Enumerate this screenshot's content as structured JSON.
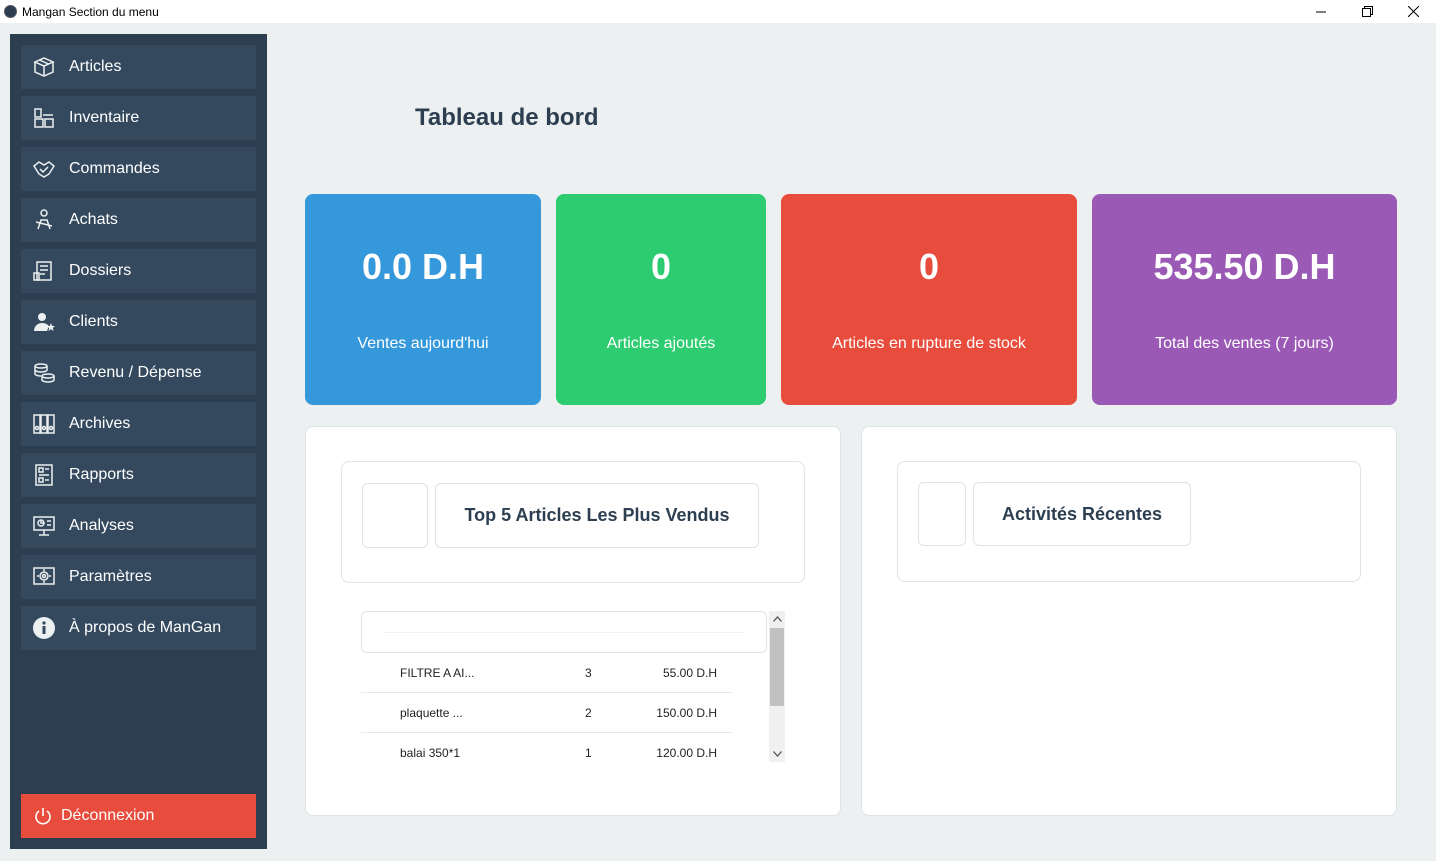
{
  "window": {
    "title": "Mangan Section du menu"
  },
  "sidebar": {
    "items": [
      {
        "label": "Articles",
        "icon": "box-icon"
      },
      {
        "label": "Inventaire",
        "icon": "warehouse-icon"
      },
      {
        "label": "Commandes",
        "icon": "handshake-icon"
      },
      {
        "label": "Achats",
        "icon": "cart-icon"
      },
      {
        "label": "Dossiers",
        "icon": "folder-icon"
      },
      {
        "label": "Clients",
        "icon": "user-star-icon"
      },
      {
        "label": "Revenu / Dépense",
        "icon": "coins-icon"
      },
      {
        "label": "Archives",
        "icon": "archive-icon"
      },
      {
        "label": "Rapports",
        "icon": "report-icon"
      },
      {
        "label": "Analyses",
        "icon": "analytics-icon"
      },
      {
        "label": "Paramètres",
        "icon": "settings-icon"
      },
      {
        "label": "À propos de ManGan",
        "icon": "info-icon"
      }
    ],
    "logout_label": "Déconnexion"
  },
  "main": {
    "title": "Tableau de bord",
    "stats": [
      {
        "value": "0.0 D.H",
        "label": "Ventes aujourd'hui",
        "color": "#3498db"
      },
      {
        "value": "0",
        "label": "Articles ajoutés",
        "color": "#2ecc71"
      },
      {
        "value": "0",
        "label": "Articles en rupture de stock",
        "color": "#e74c3c"
      },
      {
        "value": "535.50 D.H",
        "label": "Total des ventes (7 jours)",
        "color": "#9b59b6"
      }
    ],
    "top_articles": {
      "heading": "Top 5 Articles Les Plus Vendus",
      "rows": [
        {
          "name": "FILTRE A AI...",
          "qty": "3",
          "amount": "55.00 D.H"
        },
        {
          "name": "plaquette ...",
          "qty": "2",
          "amount": "150.00 D.H"
        },
        {
          "name": "balai 350*1",
          "qty": "1",
          "amount": "120.00 D.H"
        }
      ]
    },
    "recent": {
      "heading": "Activités Récentes"
    }
  }
}
